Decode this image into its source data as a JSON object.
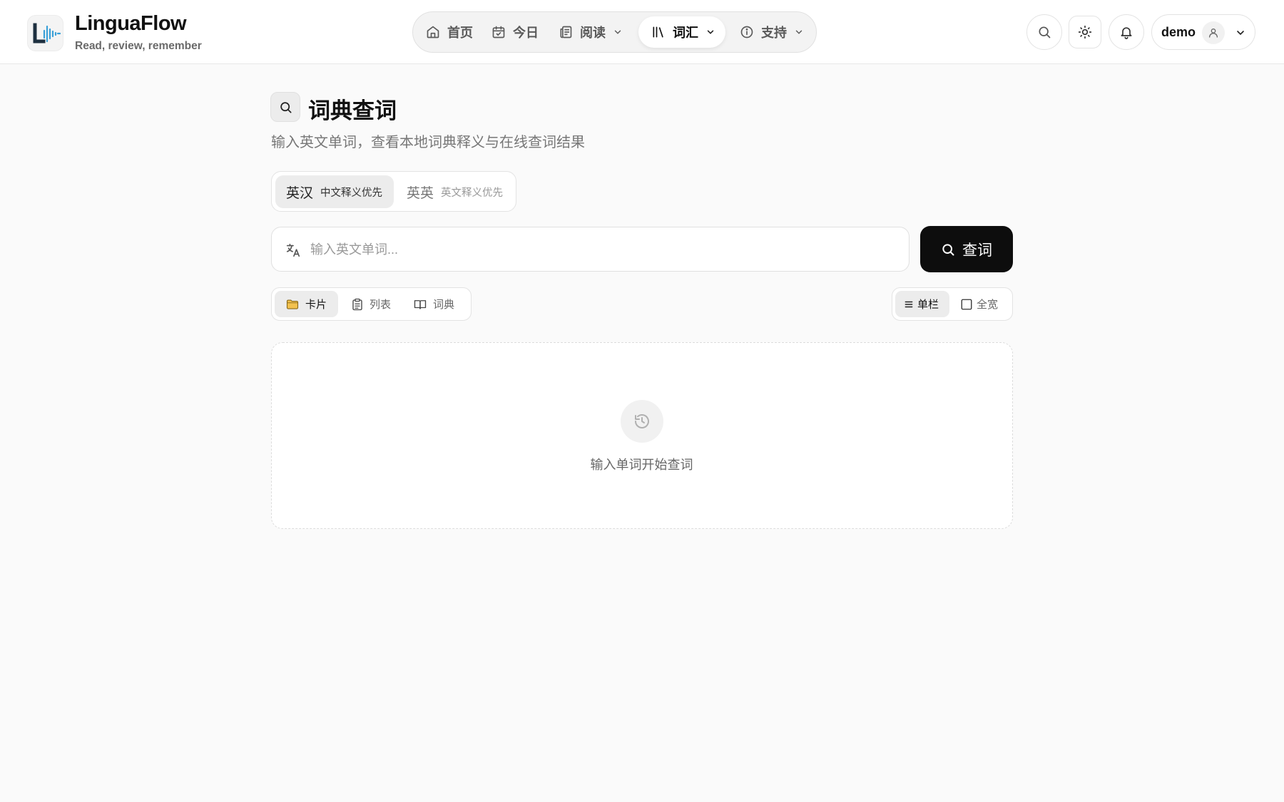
{
  "header": {
    "brand": {
      "name": "LinguaFlow",
      "tagline": "Read, review, remember"
    },
    "nav": [
      {
        "label": "首页",
        "icon": "home-icon",
        "active": false,
        "has_dropdown": false
      },
      {
        "label": "今日",
        "icon": "calendar-icon",
        "active": false,
        "has_dropdown": false
      },
      {
        "label": "阅读",
        "icon": "newspaper-icon",
        "active": false,
        "has_dropdown": true
      },
      {
        "label": "词汇",
        "icon": "library-icon",
        "active": true,
        "has_dropdown": true
      },
      {
        "label": "支持",
        "icon": "info-icon",
        "active": false,
        "has_dropdown": true
      }
    ],
    "actions": [
      "search-icon",
      "sun-icon",
      "bell-icon"
    ],
    "user": {
      "name": "demo",
      "icon": "user-icon"
    }
  },
  "page": {
    "title": "词典查词",
    "subtitle": "输入英文单词，查看本地词典释义与在线查词结果",
    "modes": [
      {
        "label": "英汉",
        "hint": "中文释义优先",
        "active": true
      },
      {
        "label": "英英",
        "hint": "英文释义优先",
        "active": false
      }
    ],
    "search": {
      "placeholder": "输入英文单词...",
      "value": "",
      "button_label": "查词"
    },
    "views": [
      {
        "label": "卡片",
        "icon": "folder-icon",
        "active": true
      },
      {
        "label": "列表",
        "icon": "clipboard-icon",
        "active": false
      },
      {
        "label": "词典",
        "icon": "book-icon",
        "active": false
      }
    ],
    "layouts": [
      {
        "label": "单栏",
        "icon": "list-icon",
        "active": true
      },
      {
        "label": "全宽",
        "icon": "square-icon",
        "active": false
      }
    ],
    "empty_state": {
      "text": "输入单词开始查词",
      "icon": "history-icon"
    }
  },
  "colors": {
    "accent": "#0d0d0d",
    "logo_wave": "#3aa0d8",
    "folder": "#f2c14e",
    "background": "#fafafa"
  }
}
